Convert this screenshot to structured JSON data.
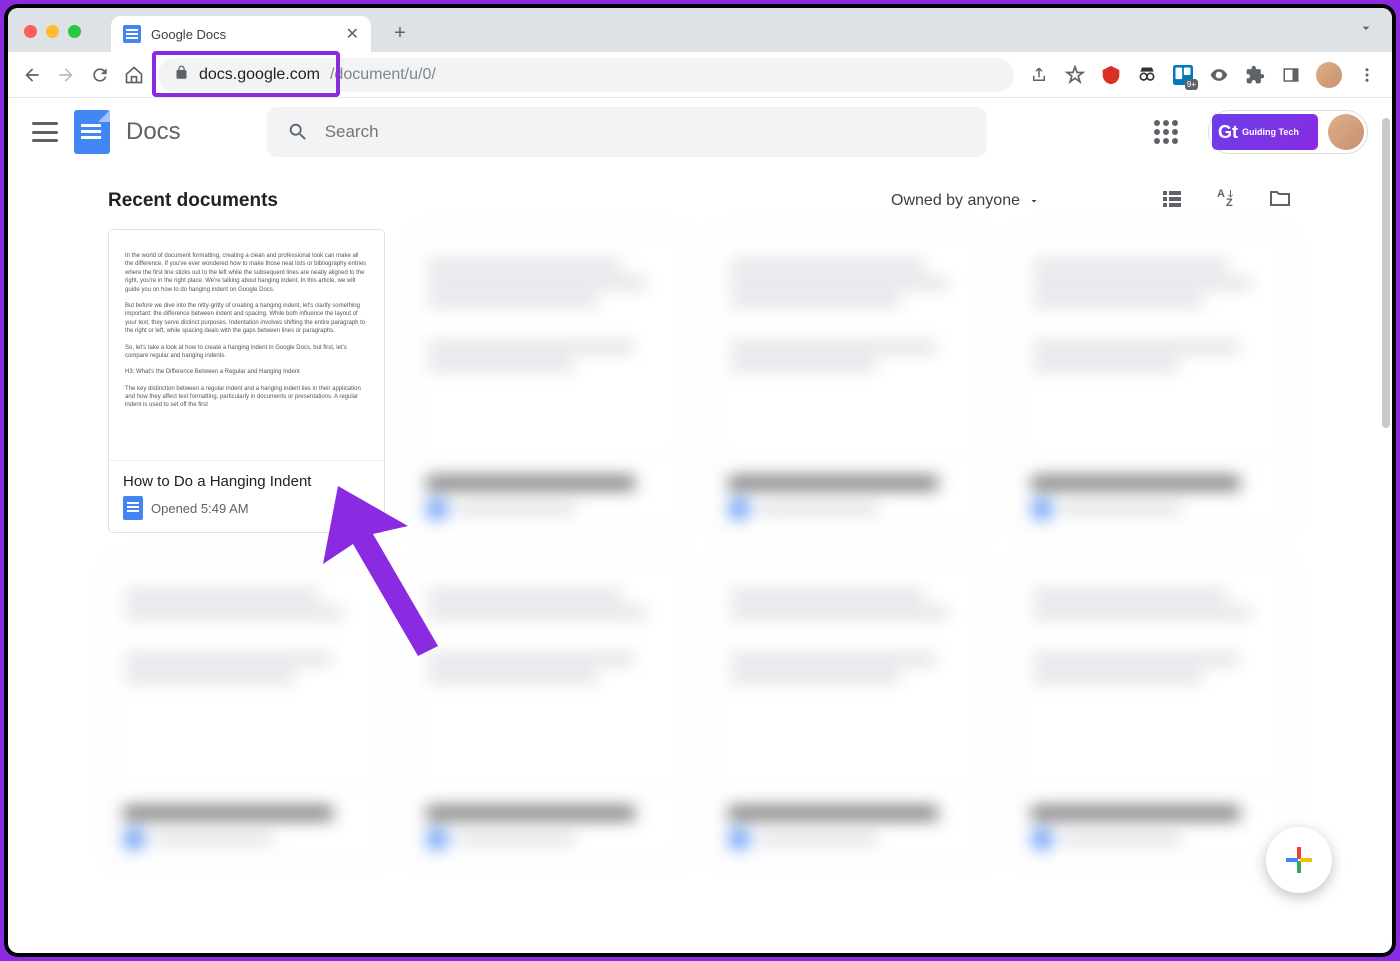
{
  "colors": {
    "red": "#ff5f57",
    "yellow": "#febc2e",
    "green": "#28c840",
    "accent": "#8a2be2",
    "blue": "#4285f4"
  },
  "browser": {
    "tab_title": "Google Docs",
    "url_domain": "docs.google.com",
    "url_path": "/document/u/0/",
    "ext_badge": "9+"
  },
  "header": {
    "app_name": "Docs",
    "search_placeholder": "Search",
    "account_brand": "Guiding Tech"
  },
  "section": {
    "title": "Recent documents",
    "owner_filter": "Owned by anyone"
  },
  "first_doc": {
    "title": "How to Do a Hanging Indent",
    "subtitle": "Opened 5:49 AM",
    "preview_p1": "In the world of document formatting, creating a clean and professional look can make all the difference. If you've ever wondered how to make those neat lists or bibliography entries where the first line sticks out to the left while the subsequent lines are neatly aligned to the right, you're in the right place. We're talking about hanging indent. In this article, we will guide you on how to do hanging indent on Google Docs.",
    "preview_p2": "But before we dive into the nitty-gritty of creating a hanging indent, let's clarify something important: the difference between indent and spacing. While both influence the layout of your text, they serve distinct purposes. Indentation involves shifting the entire paragraph to the right or left, while spacing deals with the gaps between lines or paragraphs.",
    "preview_p3": "So, let's take a look at how to create a hanging indent in Google Docs, but first, let's compare regular and hanging indents.",
    "preview_p4": "H3: What's the Difference Between a Regular and Hanging Indent",
    "preview_p5": "The key distinction between a regular indent and a hanging indent lies in their application and how they affect text formatting, particularly in documents or presentations. A regular indent is used to set off the first"
  }
}
